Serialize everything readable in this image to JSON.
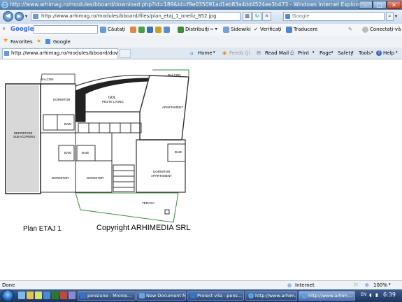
{
  "window": {
    "title": "http://www.arhimag.ro/modules/bboard/download.php?id=189&id=f9e035091ad1eb83a4dd4524ee3b473 - Windows Internet Explorer",
    "minimize": "–",
    "maximize": "□",
    "close": "✕"
  },
  "addressbar": {
    "url": "http://www.arhimag.ro/modules/bboard/files/plan_etaj_1_oneliz_852.jpg",
    "search_placeholder": "Google"
  },
  "google_toolbar": {
    "brand": "Google",
    "search_label": "Căutați",
    "distribute": "Distribuiți",
    "sidewiki": "Sidewiki",
    "check": "Verificați",
    "translate": "Traducere",
    "signin": "Conectați-vă"
  },
  "favorites_bar": {
    "favorites": "Favorites",
    "google_link": "Google"
  },
  "tabs": [
    {
      "label": "http://www.arhimag.ro/modules/bboard/download.ph..."
    }
  ],
  "command_bar": {
    "home": "Home",
    "feeds": "Feeds (J)",
    "read_mail": "Read Mail",
    "print": "Print",
    "page": "Page",
    "safety": "Safety",
    "tools": "Tools",
    "help": "Help"
  },
  "floorplan": {
    "rooms": {
      "balcon_left": "BALCON",
      "balcon_right": "BALCON",
      "dormitor_top": "DORMITOR",
      "gol_line1": "GOL",
      "gol_line2": "PESTE LIVING",
      "apartament": "APARTAMENT",
      "depozitare_line1": "DEPOZITARE",
      "depozitare_line2": "SUB ACOPERIS",
      "baie_top": "BAIE",
      "baie_mid1": "BAIE",
      "baie_mid2": "BAIE",
      "baie_right": "BAIE",
      "dormitor_bl": "DORMITOR",
      "dormitor_bm": "DORMITOR",
      "dormitor_apt_line1": "DORMITOR",
      "dormitor_apt_line2": "APARTAMENT",
      "terasa": "TERASA"
    },
    "caption_left": "Plan ETAJ 1",
    "caption_right": "Copyright ARHIMEDIA SRL"
  },
  "statusbar": {
    "status": "Done",
    "zone": "Internet",
    "zoom": "100%"
  },
  "taskbar": {
    "tasks": [
      {
        "label": "pensiune - Micros..."
      },
      {
        "label": "New Document M..."
      },
      {
        "label": "Proiect vila - pens..."
      },
      {
        "label": "http://www.arhim..."
      },
      {
        "label": "http://www.arhim..."
      }
    ],
    "language": "EN",
    "clock": "6:39"
  }
}
